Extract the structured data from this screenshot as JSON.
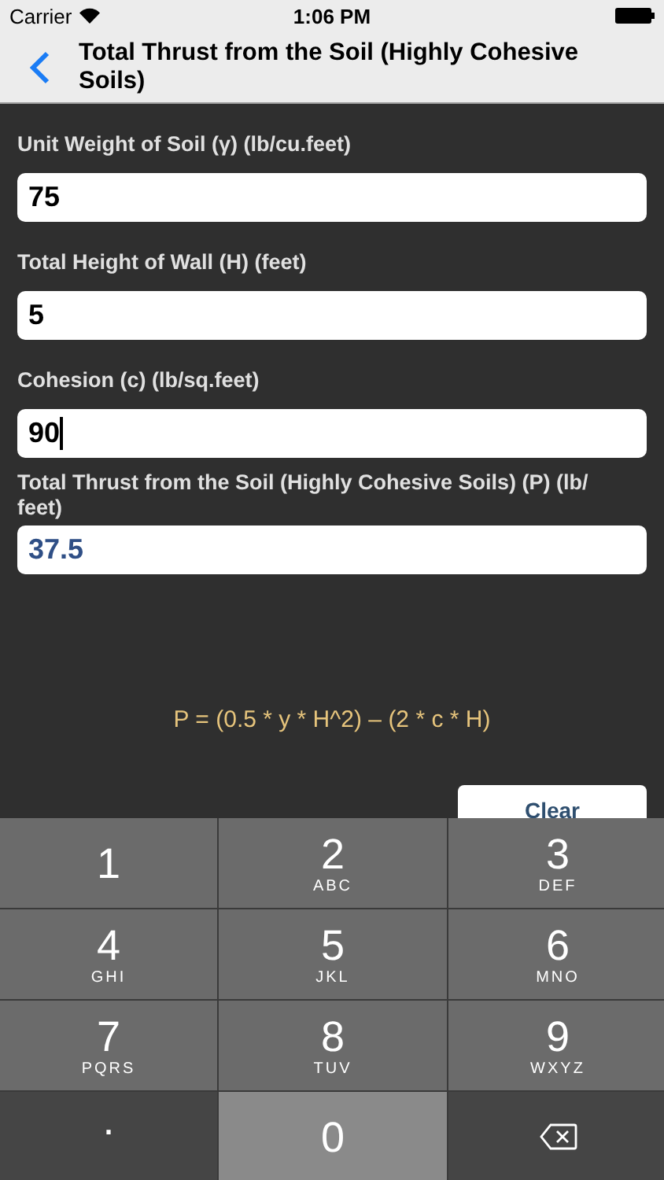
{
  "status_bar": {
    "carrier": "Carrier",
    "time": "1:06 PM"
  },
  "nav": {
    "title": "Total Thrust from the Soil (Highly Cohesive Soils)"
  },
  "fields": [
    {
      "label": "Unit Weight of Soil (γ) (lb/cu.feet)",
      "value": "75",
      "kind": "input",
      "focused": false
    },
    {
      "label": "Total Height of Wall (H) (feet)",
      "value": "5",
      "kind": "input",
      "focused": false
    },
    {
      "label": "Cohesion (c) (lb/sq.feet)",
      "value": "90",
      "kind": "input",
      "focused": true
    },
    {
      "label": "Total Thrust from the Soil (Highly Cohesive Soils) (P) (lb/ feet)",
      "value": "37.5",
      "kind": "result",
      "focused": false
    }
  ],
  "formula": "P = (0.5 * y * H^2) – (2 * c * H)",
  "clear_button": "Clear",
  "keypad": [
    {
      "kind": "digit",
      "digit": "1"
    },
    {
      "kind": "digit",
      "digit": "2",
      "letters": "ABC"
    },
    {
      "kind": "digit",
      "digit": "3",
      "letters": "DEF"
    },
    {
      "kind": "digit",
      "digit": "4",
      "letters": "GHI"
    },
    {
      "kind": "digit",
      "digit": "5",
      "letters": "JKL"
    },
    {
      "kind": "digit",
      "digit": "6",
      "letters": "MNO"
    },
    {
      "kind": "digit",
      "digit": "7",
      "letters": "PQRS"
    },
    {
      "kind": "digit",
      "digit": "8",
      "letters": "TUV"
    },
    {
      "kind": "digit",
      "digit": "9",
      "letters": "WXYZ"
    },
    {
      "kind": "decimal",
      "digit": "."
    },
    {
      "kind": "digit",
      "digit": "0"
    },
    {
      "kind": "delete"
    }
  ]
}
